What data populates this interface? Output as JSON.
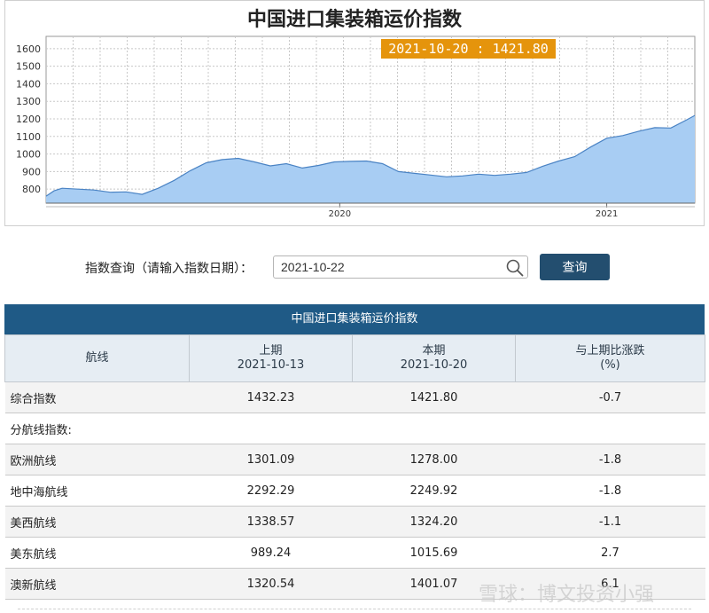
{
  "chart_data": {
    "type": "area",
    "title": "中国进口集装箱运价指数",
    "y_ticks": [
      "800",
      "900",
      "1000",
      "1100",
      "1200",
      "1300",
      "1400",
      "1500",
      "1600"
    ],
    "ylim": [
      720,
      1670
    ],
    "x_ticks": [
      {
        "label": "2020",
        "x": 11.0
      },
      {
        "label": "2021",
        "x": 21.0
      }
    ],
    "xlim": [
      0,
      24.3
    ],
    "grid": true,
    "color": "#a8cdf3",
    "line_color": "#4a83c4",
    "tooltip": "2021-10-20 : 1421.80",
    "series": [
      {
        "values": [
          [
            0,
            760
          ],
          [
            0.3,
            790
          ],
          [
            0.6,
            805
          ],
          [
            1.2,
            800
          ],
          [
            1.8,
            795
          ],
          [
            2.4,
            782
          ],
          [
            3.0,
            784
          ],
          [
            3.6,
            770
          ],
          [
            4.2,
            805
          ],
          [
            4.8,
            850
          ],
          [
            5.4,
            905
          ],
          [
            6.0,
            950
          ],
          [
            6.6,
            968
          ],
          [
            7.2,
            975
          ],
          [
            7.8,
            955
          ],
          [
            8.4,
            932
          ],
          [
            9.0,
            945
          ],
          [
            9.6,
            920
          ],
          [
            10.2,
            935
          ],
          [
            10.8,
            955
          ],
          [
            11.4,
            958
          ],
          [
            12.0,
            960
          ],
          [
            12.6,
            945
          ],
          [
            13.2,
            900
          ],
          [
            13.8,
            890
          ],
          [
            14.4,
            880
          ],
          [
            15.0,
            870
          ],
          [
            15.6,
            875
          ],
          [
            16.2,
            885
          ],
          [
            16.8,
            878
          ],
          [
            17.4,
            885
          ],
          [
            18.0,
            895
          ],
          [
            18.6,
            930
          ],
          [
            19.2,
            960
          ],
          [
            19.8,
            985
          ],
          [
            20.4,
            1040
          ],
          [
            21.0,
            1090
          ],
          [
            21.6,
            1105
          ],
          [
            22.2,
            1130
          ],
          [
            22.8,
            1150
          ],
          [
            23.4,
            1148
          ],
          [
            24.0,
            1195
          ],
          [
            24.3,
            1220
          ]
        ]
      }
    ]
  },
  "query": {
    "label": "指数查询（请输入指数日期）：",
    "date_value": "2021-10-22",
    "button": "查询"
  },
  "table": {
    "caption": "中国进口集装箱运价指数",
    "headers": [
      "航线",
      "上期\n2021-10-13",
      "本期\n2021-10-20",
      "与上期比涨跌\n(%)"
    ],
    "rows": [
      [
        "综合指数",
        "1432.23",
        "1421.80",
        "-0.7"
      ],
      [
        "分航线指数:",
        "",
        "",
        ""
      ],
      [
        "欧洲航线",
        "1301.09",
        "1278.00",
        "-1.8"
      ],
      [
        "地中海航线",
        "2292.29",
        "2249.92",
        "-1.8"
      ],
      [
        "美西航线",
        "1338.57",
        "1324.20",
        "-1.1"
      ],
      [
        "美东航线",
        "989.24",
        "1015.69",
        "2.7"
      ],
      [
        "澳新航线",
        "1320.54",
        "1401.07",
        "6.1"
      ]
    ]
  },
  "watermark": "雪球：博文投资小强"
}
